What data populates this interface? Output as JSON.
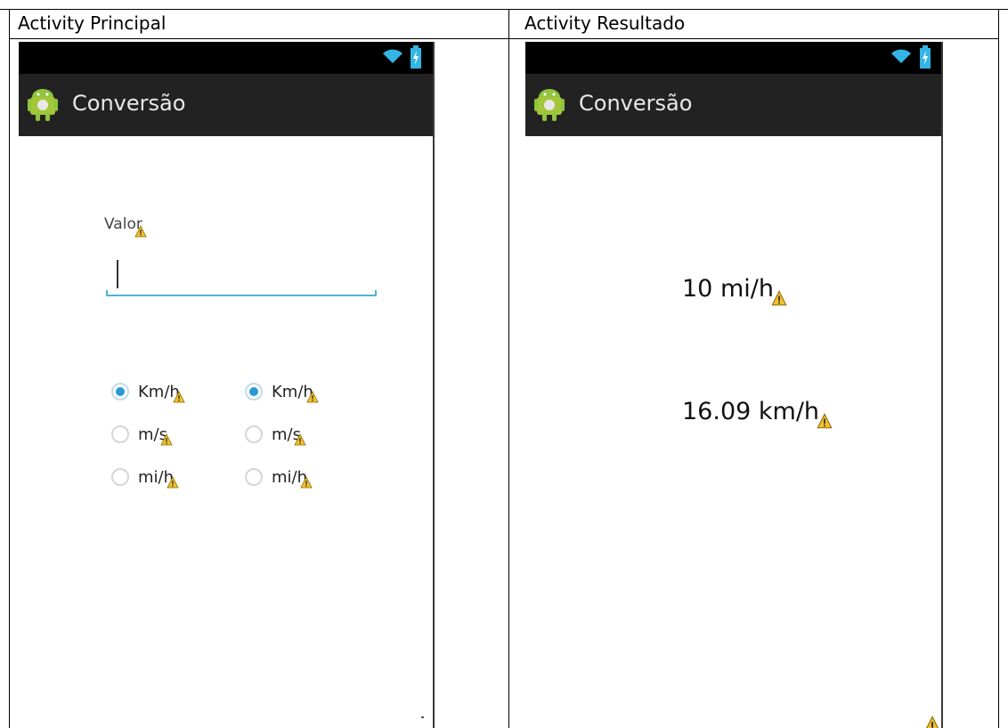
{
  "headers": {
    "left": "Activity Principal",
    "right": "Activity Resultado"
  },
  "app": {
    "title": "Conversão"
  },
  "principal": {
    "input_label": "Valor",
    "input_value": "",
    "radio_group_from": [
      {
        "label": "Km/h",
        "checked": true
      },
      {
        "label": "m/s",
        "checked": false
      },
      {
        "label": "mi/h",
        "checked": false
      }
    ],
    "radio_group_to": [
      {
        "label": "Km/h",
        "checked": true
      },
      {
        "label": "m/s",
        "checked": false
      },
      {
        "label": "mi/h",
        "checked": false
      }
    ]
  },
  "resultado": {
    "source_value": "10 mi/h",
    "converted_value": "16.09 km/h"
  },
  "colors": {
    "statusbar": "#000000",
    "actionbar": "#222222",
    "accent": "#4bb4dc",
    "radio_checked": "#2a9ad4",
    "warning": "#f2c12e"
  },
  "icons": [
    "android-icon",
    "wifi-icon",
    "battery-icon",
    "warning-icon"
  ]
}
